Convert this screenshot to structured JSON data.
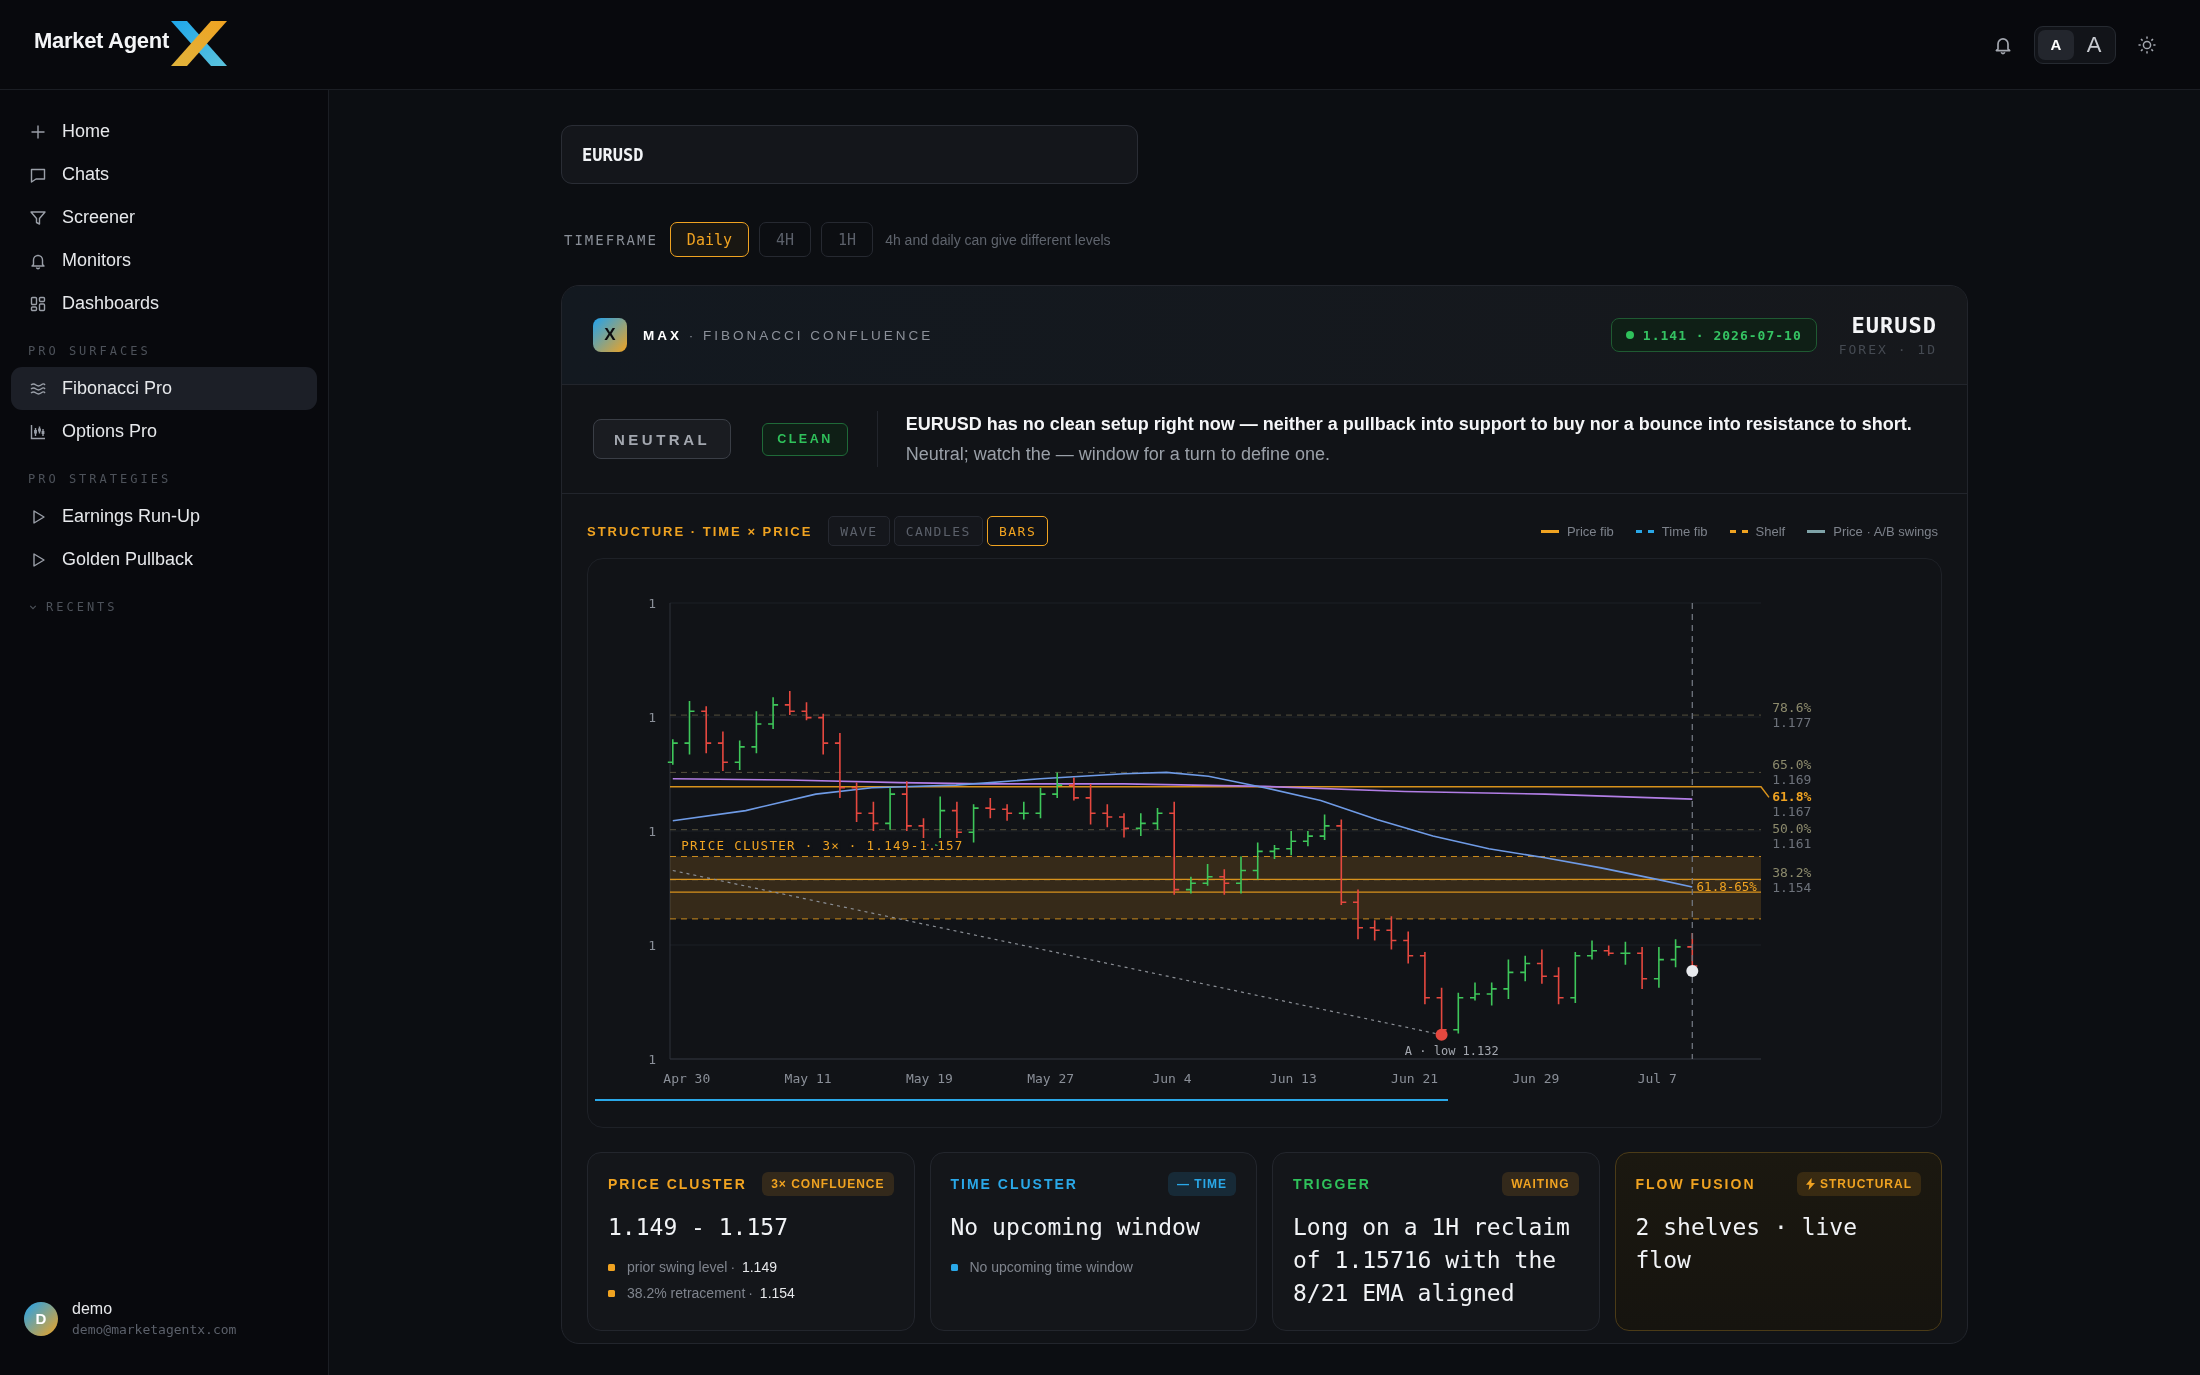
{
  "header": {
    "brand": "Market Agent",
    "text_size_options": [
      {
        "label": "A",
        "kind": "small",
        "selected": true
      },
      {
        "label": "A",
        "kind": "large",
        "selected": false
      }
    ]
  },
  "sidebar": {
    "nav": [
      {
        "label": "Home",
        "selected": false
      },
      {
        "label": "Chats",
        "selected": false
      },
      {
        "label": "Screener",
        "selected": false
      },
      {
        "label": "Monitors",
        "selected": false
      },
      {
        "label": "Dashboards",
        "selected": false
      }
    ],
    "sections": [
      {
        "title": "PRO SURFACES",
        "kind": "group",
        "items": [
          {
            "label": "Fibonacci Pro",
            "selected": true
          },
          {
            "label": "Options Pro",
            "selected": false
          }
        ]
      },
      {
        "title": "PRO STRATEGIES",
        "kind": "group",
        "items": [
          {
            "label": "Earnings Run-Up",
            "selected": false
          },
          {
            "label": "Golden Pullback",
            "selected": false
          }
        ]
      },
      {
        "title": "RECENTS",
        "kind": "collapsible"
      }
    ],
    "user": {
      "initial": "D",
      "name": "demo",
      "email": "demo@marketagentx.com"
    }
  },
  "search": {
    "value": "EURUSD"
  },
  "timeframe": {
    "label": "TIMEFRAME",
    "options": [
      {
        "label": "Daily",
        "selected": true
      },
      {
        "label": "4H",
        "selected": false
      },
      {
        "label": "1H",
        "selected": false
      }
    ],
    "hint": "4h and daily can give different levels"
  },
  "analysis": {
    "agent_badge": "X",
    "agent_title": "**MAX** · FIBONACCI CONFLUENCE",
    "quote": "1.141 · 2026-07-10",
    "symbol": "EURUSD",
    "market": "FOREX · 1D",
    "tags": [
      {
        "label": "NEUTRAL",
        "kind": "stance"
      },
      {
        "label": "CLEAN",
        "kind": "quality"
      }
    ],
    "summary": "**EURUSD has no clean setup right now — neither a pullback into support to buy nor a bounce into resistance to short.** Neutral; watch the — window for a turn to define one."
  },
  "chart_panel": {
    "title": "STRUCTURE · TIME × PRICE",
    "modes": [
      {
        "label": "WAVE",
        "selected": false
      },
      {
        "label": "CANDLES",
        "selected": false
      },
      {
        "label": "BARS",
        "selected": true
      }
    ],
    "legend": [
      {
        "label": "Price fib",
        "color": "#f0a321",
        "kind": "solid"
      },
      {
        "label": "Time fib",
        "color": "#2aa8e8",
        "kind": "dashed"
      },
      {
        "label": "Shelf",
        "color": "#f0a321",
        "kind": "dashed"
      },
      {
        "label": "Price · A/B swings",
        "color": "#7fa3a8",
        "kind": "solid"
      }
    ],
    "y_ticks": [
      "1",
      "1",
      "1",
      "1",
      "1"
    ],
    "x_ticks": [
      "Apr 30",
      "May 11",
      "May 19",
      "May 27",
      "Jun 4",
      "Jun 13",
      "Jun 21",
      "Jun 29",
      "Jul 7"
    ],
    "fib_levels": [
      {
        "percent": "78.6%",
        "price": "1.177",
        "highlighted": false
      },
      {
        "percent": "65.0%",
        "price": "1.169",
        "highlighted": false
      },
      {
        "percent": "61.8%",
        "price": "1.167",
        "highlighted": true
      },
      {
        "percent": "50.0%",
        "price": "1.161",
        "highlighted": false
      },
      {
        "percent": "38.2%",
        "price": "1.154",
        "highlighted": false
      }
    ],
    "cluster_label": "PRICE CLUSTER · 3× · 1.149-1.157",
    "band_label": "61.8-65%",
    "swing_label": "A · low 1.132"
  },
  "cards": [
    {
      "title": "PRICE CLUSTER",
      "color": "#f0a321",
      "highlighted": false,
      "badge": {
        "label": "3× CONFLUENCE",
        "color": "#f0a321",
        "kind": "plain"
      },
      "headline": "1.149 - 1.157",
      "bullets": [
        {
          "label": "prior swing level",
          "separator": "·",
          "value": "1.149"
        },
        {
          "label": "38.2% retracement",
          "separator": "·",
          "value": "1.154"
        }
      ]
    },
    {
      "title": "TIME CLUSTER",
      "color": "#2aa8e8",
      "highlighted": false,
      "badge": {
        "label": "— TIME",
        "color": "#2aa8e8",
        "kind": "plain"
      },
      "headline": "No upcoming window",
      "bullets": [
        {
          "label": "No upcoming time window"
        }
      ]
    },
    {
      "title": "TRIGGER",
      "color": "#2fc25b",
      "highlighted": false,
      "badge": {
        "label": "WAITING",
        "color": "#f0a321",
        "kind": "plain"
      },
      "headline": "Long on a 1H reclaim of 1.15716 with the 8/21 EMA aligned"
    },
    {
      "title": "FLOW FUSION",
      "color": "#f0a321",
      "highlighted": true,
      "badge": {
        "label": "STRUCTURAL",
        "color": "#f0a321",
        "kind": "flagged"
      },
      "headline": "2 shelves · live flow"
    }
  ]
}
